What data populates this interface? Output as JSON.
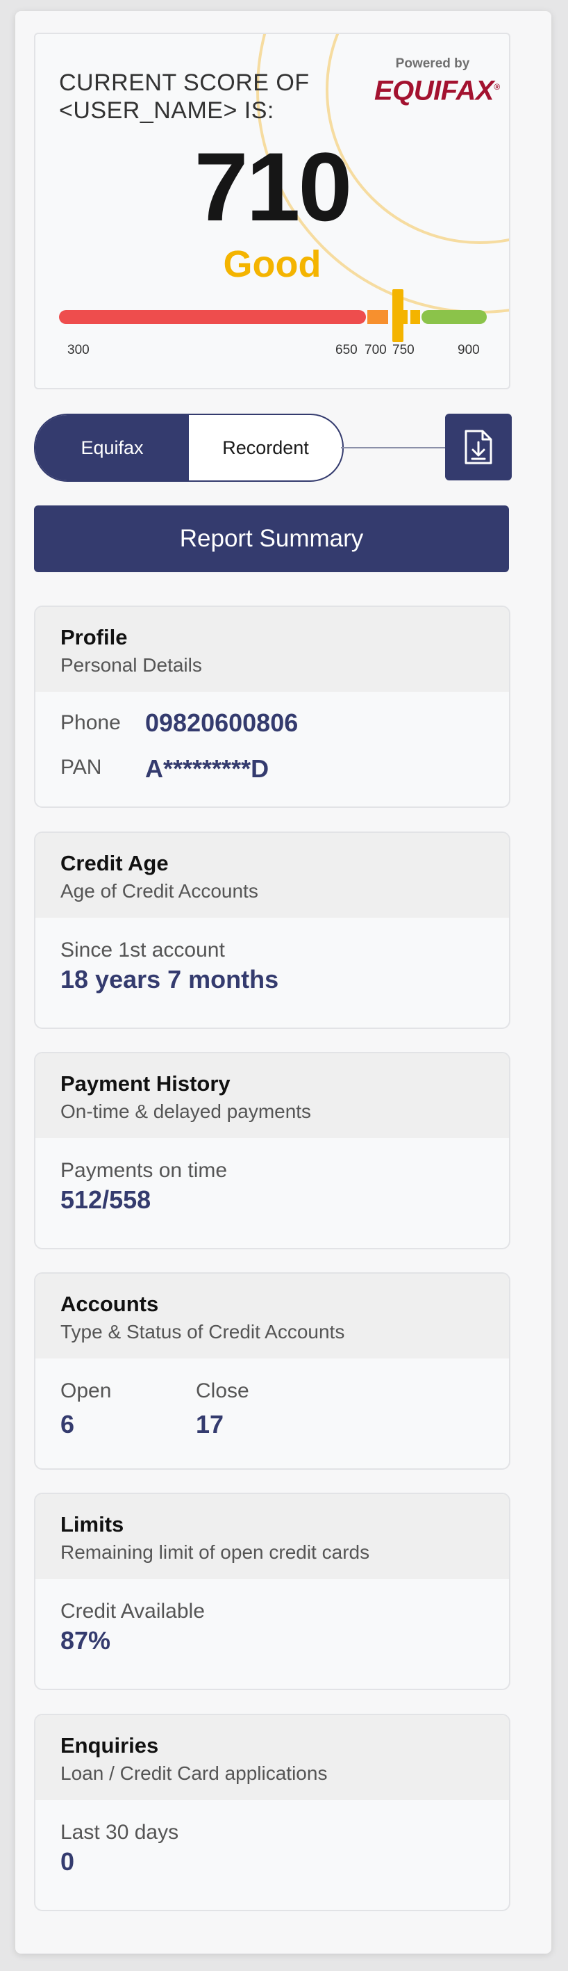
{
  "score": {
    "title_line1": "CURRENT SCORE OF",
    "title_line2": "<USER_NAME> IS:",
    "powered_by": "Powered by",
    "brand": "EQUIFAX",
    "value": "710",
    "rating": "Good",
    "scale_labels": [
      "300",
      "650",
      "700",
      "750",
      "900"
    ],
    "scale_min": 300,
    "scale_max": 900,
    "score_number": 710,
    "colors": {
      "poor": "#ee4d4d",
      "fair": "#f7902e",
      "good": "#f4b400",
      "excellent": "#8bc34a"
    }
  },
  "toggle": {
    "tab_active": "Equifax",
    "tab_inactive": "Recordent"
  },
  "report_summary": "Report Summary",
  "profile": {
    "title": "Profile",
    "subtitle": "Personal Details",
    "phone_label": "Phone",
    "phone_value": "09820600806",
    "pan_label": "PAN",
    "pan_value": "A*********D"
  },
  "credit_age": {
    "title": "Credit Age",
    "subtitle": "Age of Credit Accounts",
    "label": "Since 1st account",
    "value": "18 years 7 months"
  },
  "payment_history": {
    "title": "Payment History",
    "subtitle": "On-time & delayed payments",
    "label": "Payments on time",
    "value": "512/558"
  },
  "accounts": {
    "title": "Accounts",
    "subtitle": "Type & Status of Credit Accounts",
    "open_label": "Open",
    "open_value": "6",
    "close_label": "Close",
    "close_value": "17"
  },
  "limits": {
    "title": "Limits",
    "subtitle": "Remaining limit of open credit cards",
    "label": "Credit Available",
    "value": "87%"
  },
  "enquiries": {
    "title": "Enquiries",
    "subtitle": "Loan / Credit Card applications",
    "label": "Last 30 days",
    "value": "0"
  }
}
